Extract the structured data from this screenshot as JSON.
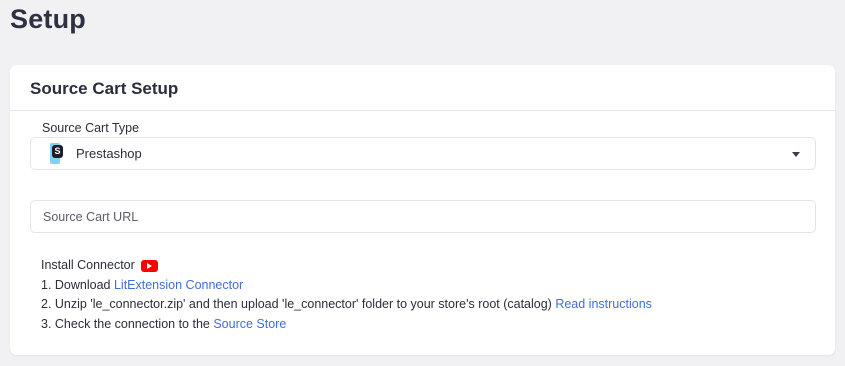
{
  "page": {
    "title": "Setup"
  },
  "card": {
    "title": "Source Cart Setup",
    "cart_type": {
      "label": "Source Cart Type",
      "value": "Prestashop",
      "icon": "prestashop-logo-icon"
    },
    "cart_url": {
      "placeholder": "Source Cart URL",
      "value": ""
    },
    "connector": {
      "title": "Install Connector",
      "video_icon": "youtube-icon",
      "step1_prefix": "1. Download ",
      "step1_link": "LitExtension Connector",
      "step2_prefix": "2. Unzip 'le_connector.zip' and then upload 'le_connector' folder to your store's root (catalog) ",
      "step2_link": "Read instructions",
      "step3_prefix": "3. Check the connection to the ",
      "step3_link": "Source Store"
    }
  },
  "colors": {
    "link": "#3f6fd8",
    "youtube": "#ff0000",
    "background": "#f1f1f3"
  }
}
